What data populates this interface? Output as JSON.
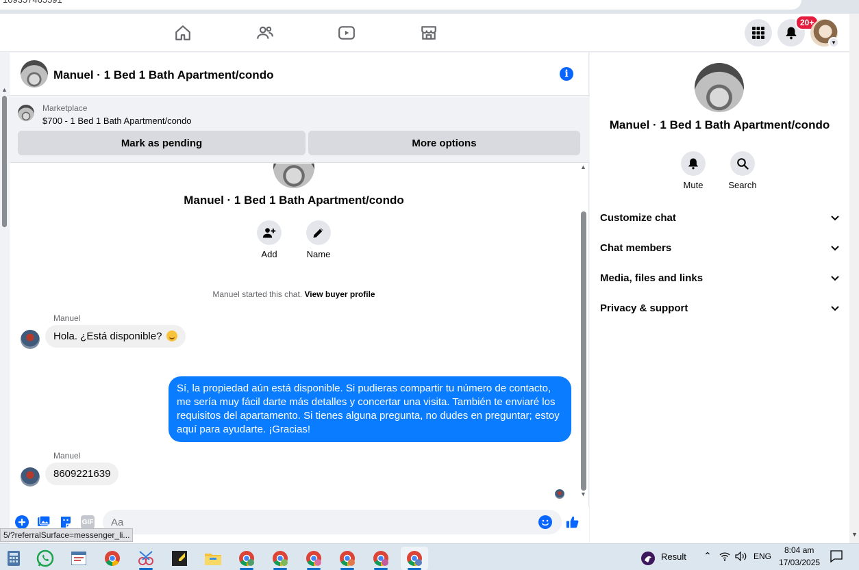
{
  "browser": {
    "url_fragment": "109357465591"
  },
  "nav": {
    "notifications_badge": "20+"
  },
  "chat": {
    "title": "Manuel · 1 Bed 1 Bath Apartment/condo",
    "marketplace": {
      "label": "Marketplace",
      "listing": "$700 - 1 Bed 1 Bath Apartment/condo",
      "pending_button": "Mark as pending",
      "options_button": "More options"
    },
    "intro": {
      "title": "Manuel · 1 Bed 1 Bath Apartment/condo",
      "add_label": "Add",
      "name_label": "Name",
      "started_text": "Manuel started this chat.",
      "view_profile": "View buyer profile"
    },
    "messages": [
      {
        "sender": "Manuel",
        "text": "Hola. ¿Está disponible?"
      },
      {
        "sender": "me",
        "text": "Sí, la propiedad aún está disponible. Si pudieras compartir tu número de contacto, me sería muy fácil darte más detalles y concertar una visita. También te enviaré los requisitos del apartamento. Si tienes alguna pregunta, no dudes en preguntar; estoy aquí para ayudarte. ¡Gracias!"
      },
      {
        "sender": "Manuel",
        "text": "8609221639"
      }
    ],
    "composer": {
      "placeholder": "Aa",
      "gif_label": "GIF"
    },
    "status_link": "5/?referralSurface=messenger_li..."
  },
  "panel": {
    "title": "Manuel · 1 Bed 1 Bath Apartment/condo",
    "mute_label": "Mute",
    "search_label": "Search",
    "sections": [
      "Customize chat",
      "Chat members",
      "Media, files and links",
      "Privacy & support"
    ]
  },
  "taskbar": {
    "result_label": "Result",
    "language": "ENG",
    "time": "8:04 am",
    "date": "17/03/2025"
  },
  "colors": {
    "accent": "#0866ff",
    "outgoing_bubble": "#0a7cff",
    "incoming_bubble": "#f0f0f0",
    "badge": "#e41e3f"
  }
}
